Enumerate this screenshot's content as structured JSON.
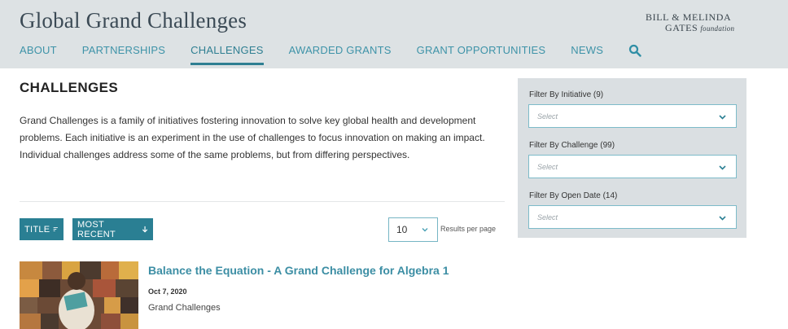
{
  "header": {
    "site_title": "Global Grand Challenges",
    "logo": {
      "line1": "BILL & MELINDA",
      "line2": "GATES",
      "foundation": "foundation"
    },
    "nav": [
      {
        "label": "ABOUT",
        "active": false
      },
      {
        "label": "PARTNERSHIPS",
        "active": false
      },
      {
        "label": "CHALLENGES",
        "active": true
      },
      {
        "label": "AWARDED GRANTS",
        "active": false
      },
      {
        "label": "GRANT OPPORTUNITIES",
        "active": false
      },
      {
        "label": "NEWS",
        "active": false
      }
    ],
    "search_icon": "search-icon"
  },
  "main": {
    "page_title": "CHALLENGES",
    "intro": "Grand Challenges is a family of initiatives fostering innovation to solve key global health and development problems. Each initiative is an experiment in the use of challenges to focus innovation on making an impact. Individual challenges address some of the same problems, but from differing perspectives.",
    "sort": {
      "title_label": "TITLE",
      "recent_label": "MOST RECENT"
    },
    "per_page": {
      "value": "10",
      "label": "Results per page"
    },
    "results": [
      {
        "title": "Balance the Equation - A Grand Challenge for Algebra 1",
        "date": "Oct 7, 2020",
        "category": "Grand Challenges"
      }
    ]
  },
  "filters": [
    {
      "label": "Filter By Initiative (9)",
      "placeholder": "Select"
    },
    {
      "label": "Filter By Challenge (99)",
      "placeholder": "Select"
    },
    {
      "label": "Filter By Open Date (14)",
      "placeholder": "Select"
    }
  ],
  "colors": {
    "accent": "#2a7f93",
    "nav_text": "#3e93a8",
    "header_bg": "#dde2e4",
    "panel_bg": "#dadfe2"
  }
}
